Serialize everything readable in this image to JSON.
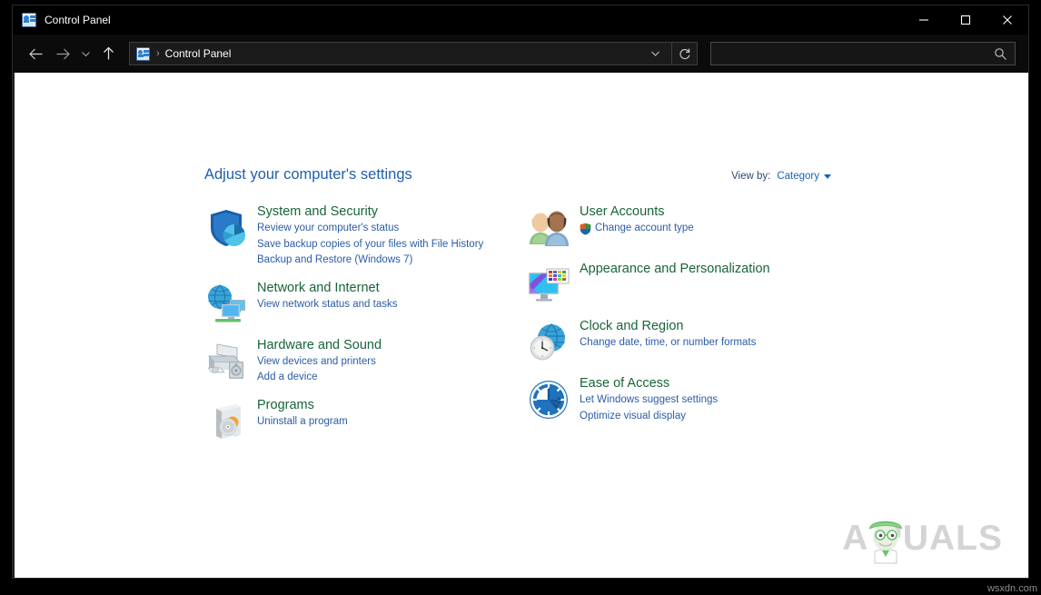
{
  "window": {
    "title": "Control Panel",
    "titlebar_icon": "control-panel-icon",
    "minimize_label": "Minimize",
    "maximize_label": "Maximize",
    "close_label": "Close"
  },
  "toolbar": {
    "back_icon": "arrow-left-icon",
    "forward_icon": "arrow-right-icon",
    "recent_icon": "chevron-down-icon",
    "up_icon": "arrow-up-icon",
    "breadcrumb": {
      "icon": "control-panel-icon",
      "separator": "›",
      "path": "Control Panel",
      "dropdown_icon": "chevron-down-icon"
    },
    "refresh_icon": "refresh-icon",
    "search": {
      "value": "",
      "placeholder": "",
      "icon": "search-icon"
    }
  },
  "main": {
    "page_title": "Adjust your computer's settings",
    "view_by": {
      "label": "View by:",
      "value": "Category",
      "caret_icon": "caret-down-icon"
    },
    "left_column": [
      {
        "icon": "shield-chart-icon",
        "title": "System and Security",
        "links": [
          "Review your computer's status",
          "Save backup copies of your files with File History",
          "Backup and Restore (Windows 7)"
        ]
      },
      {
        "icon": "globe-monitors-icon",
        "title": "Network and Internet",
        "links": [
          "View network status and tasks"
        ]
      },
      {
        "icon": "printer-speaker-icon",
        "title": "Hardware and Sound",
        "links": [
          "View devices and printers",
          "Add a device"
        ]
      },
      {
        "icon": "software-box-icon",
        "title": "Programs",
        "links": [
          "Uninstall a program"
        ]
      }
    ],
    "right_column": [
      {
        "icon": "two-users-icon",
        "title": "User Accounts",
        "links": [
          "Change account type"
        ],
        "shield_on_first_link": true
      },
      {
        "icon": "monitor-palette-icon",
        "title": "Appearance and Personalization",
        "links": []
      },
      {
        "icon": "globe-clock-icon",
        "title": "Clock and Region",
        "links": [
          "Change date, time, or number formats"
        ]
      },
      {
        "icon": "accessibility-icon",
        "title": "Ease of Access",
        "links": [
          "Let Windows suggest settings",
          "Optimize visual display"
        ]
      }
    ]
  },
  "watermark": {
    "brand": "A  PUALS",
    "brand_prefix": "A",
    "brand_suffix": "PUALS",
    "mascot_icon": "appuals-mascot-icon",
    "site_tag": "wsxdn.com"
  },
  "colors": {
    "category_title": "#17653a",
    "category_link": "#2a5ca8",
    "page_title": "#1f5fae",
    "titlebar_bg": "#000000",
    "content_bg": "#ffffff",
    "accent_edge": "#7a1236"
  }
}
